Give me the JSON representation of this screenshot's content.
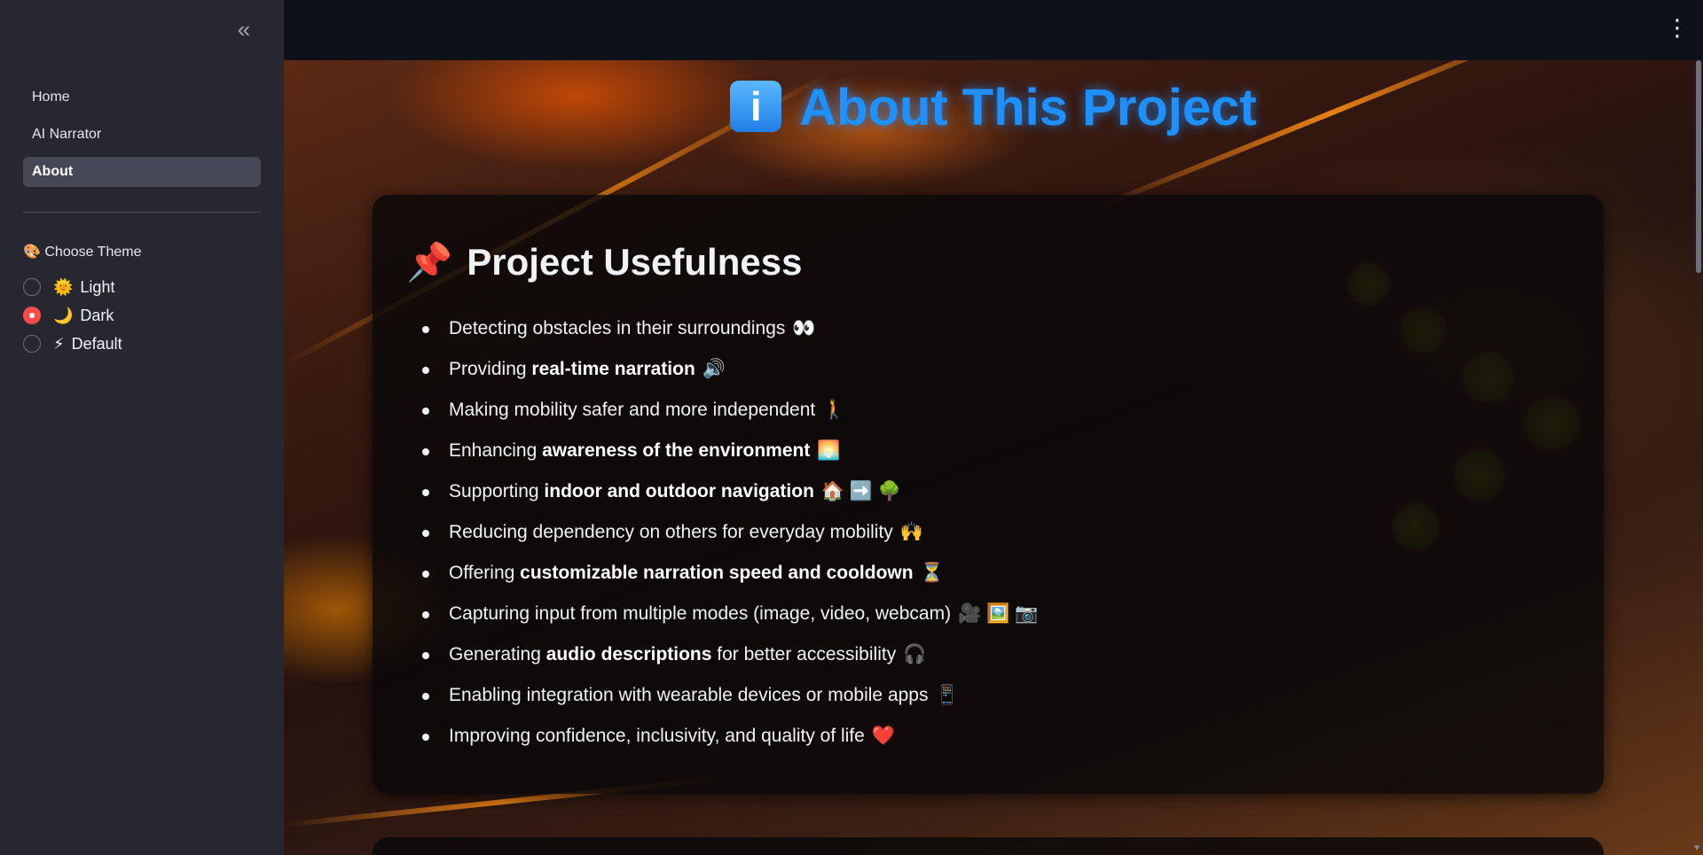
{
  "sidebar": {
    "collapse_icon": "«",
    "nav": [
      {
        "label": "Home",
        "active": false
      },
      {
        "label": "AI Narrator",
        "active": false
      },
      {
        "label": "About",
        "active": true
      }
    ],
    "theme_label": "🎨 Choose Theme",
    "theme_options": [
      {
        "emoji": "🌞",
        "label": "Light",
        "selected": false
      },
      {
        "emoji": "🌙",
        "label": "Dark",
        "selected": true
      },
      {
        "emoji": "⚡",
        "label": "Default",
        "selected": false
      }
    ]
  },
  "topbar": {
    "menu_icon": "⋮"
  },
  "main": {
    "title_icon": "i",
    "title": "About This Project",
    "section": {
      "pin": "📌",
      "heading": "Project Usefulness",
      "items": [
        {
          "before": "Detecting obstacles in their surroundings",
          "bold": "",
          "after": "",
          "emoji": "👀"
        },
        {
          "before": "Providing ",
          "bold": "real-time narration",
          "after": "",
          "emoji": "🔊"
        },
        {
          "before": "Making mobility safer and more independent",
          "bold": "",
          "after": "",
          "emoji": "🚶"
        },
        {
          "before": "Enhancing ",
          "bold": "awareness of the environment",
          "after": "",
          "emoji": "🌅"
        },
        {
          "before": "Supporting ",
          "bold": "indoor and outdoor navigation",
          "after": "",
          "emoji": "🏠 ➡️ 🌳"
        },
        {
          "before": "Reducing dependency on others for everyday mobility",
          "bold": "",
          "after": "",
          "emoji": "🙌"
        },
        {
          "before": "Offering ",
          "bold": "customizable narration speed and cooldown",
          "after": "",
          "emoji": "⏳"
        },
        {
          "before": "Capturing input from multiple modes (image, video, webcam)",
          "bold": "",
          "after": "",
          "emoji": "🎥 🖼️ 📷"
        },
        {
          "before": "Generating ",
          "bold": "audio descriptions",
          "after": " for better accessibility",
          "emoji": "🎧"
        },
        {
          "before": "Enabling integration with wearable devices or mobile apps",
          "bold": "",
          "after": "",
          "emoji": "📱"
        },
        {
          "before": "Improving confidence, inclusivity, and quality of life",
          "bold": "",
          "after": "",
          "emoji": "❤️"
        }
      ]
    }
  }
}
